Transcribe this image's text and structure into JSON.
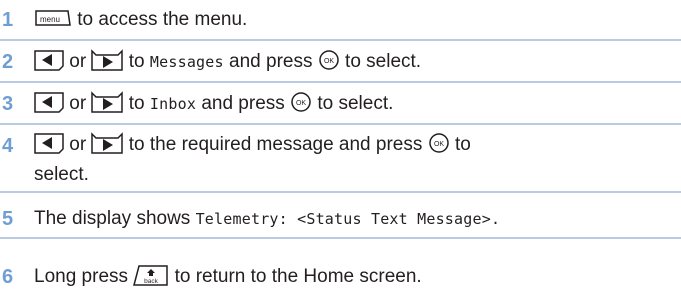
{
  "steps": [
    {
      "num": "1",
      "a": "to access the menu."
    },
    {
      "num": "2",
      "or": "or",
      "to": "to",
      "target": "Messages",
      "press": "and press",
      "end": "to select."
    },
    {
      "num": "3",
      "or": "or",
      "to": "to",
      "target": "Inbox",
      "press": "and press",
      "end": "to select."
    },
    {
      "num": "4",
      "or": "or",
      "text": "to the required message and press",
      "to": "to",
      "end2": "select."
    },
    {
      "num": "5",
      "text": "The display shows",
      "mono": "Telemetry: <Status Text Message>."
    },
    {
      "num": "6",
      "text": "Long press",
      "end": "to return to the Home screen."
    }
  ],
  "icons": {
    "menu_key": "menu",
    "ok_key": "OK",
    "back_key": "back"
  },
  "colors": {
    "step_number": "#6f9ed3",
    "divider": "#b9cbe0"
  }
}
